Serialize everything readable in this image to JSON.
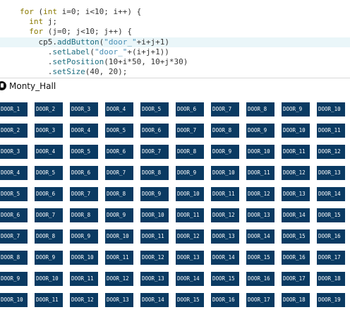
{
  "editor": {
    "lines": [
      [
        {
          "c": "kw",
          "t": "for"
        },
        {
          "c": "tx",
          "t": " ("
        },
        {
          "c": "kw",
          "t": "int"
        },
        {
          "c": "tx",
          "t": " i=0; i<10; i++) {"
        }
      ],
      [
        {
          "c": "tx",
          "t": "  "
        },
        {
          "c": "kw",
          "t": "int"
        },
        {
          "c": "tx",
          "t": " j;"
        }
      ],
      [
        {
          "c": "tx",
          "t": "  "
        },
        {
          "c": "kw",
          "t": "for"
        },
        {
          "c": "tx",
          "t": " (j=0; j<10; j++) {"
        }
      ],
      [
        {
          "c": "tx",
          "t": "    cp5."
        },
        {
          "c": "fn",
          "t": "addButton"
        },
        {
          "c": "tx",
          "t": "("
        },
        {
          "c": "str",
          "t": "\"door_\""
        },
        {
          "c": "tx",
          "t": "+i+j+1)"
        }
      ],
      [
        {
          "c": "tx",
          "t": "      ."
        },
        {
          "c": "fn",
          "t": "setLabel"
        },
        {
          "c": "tx",
          "t": "("
        },
        {
          "c": "str",
          "t": "\"door_\""
        },
        {
          "c": "tx",
          "t": "+(i+j+1))"
        }
      ],
      [
        {
          "c": "tx",
          "t": "      ."
        },
        {
          "c": "fn",
          "t": "setPosition"
        },
        {
          "c": "tx",
          "t": "(10+i*50, 10+j*30)"
        }
      ],
      [
        {
          "c": "tx",
          "t": "      ."
        },
        {
          "c": "fn",
          "t": "setSize"
        },
        {
          "c": "tx",
          "t": "(40, 20);"
        }
      ]
    ],
    "highlighted_line": 3
  },
  "window": {
    "title": "Monty_Hall"
  },
  "doors": {
    "columns": 10,
    "rows": 10,
    "rows_labels": [
      [
        "DOOR_1",
        "DOOR_2",
        "DOOR_3",
        "DOOR_4",
        "DOOR_5",
        "DOOR_6",
        "DOOR_7",
        "DOOR_8",
        "DOOR_9",
        "DOOR_10"
      ],
      [
        "DOOR_2",
        "DOOR_3",
        "DOOR_4",
        "DOOR_5",
        "DOOR_6",
        "DOOR_7",
        "DOOR_8",
        "DOOR_9",
        "DOOR_10",
        "DOOR_11"
      ],
      [
        "DOOR_3",
        "DOOR_4",
        "DOOR_5",
        "DOOR_6",
        "DOOR_7",
        "DOOR_8",
        "DOOR_9",
        "DOOR_10",
        "DOOR_11",
        "DOOR_12"
      ],
      [
        "DOOR_4",
        "DOOR_5",
        "DOOR_6",
        "DOOR_7",
        "DOOR_8",
        "DOOR_9",
        "DOOR_10",
        "DOOR_11",
        "DOOR_12",
        "DOOR_13"
      ],
      [
        "DOOR_5",
        "DOOR_6",
        "DOOR_7",
        "DOOR_8",
        "DOOR_9",
        "DOOR_10",
        "DOOR_11",
        "DOOR_12",
        "DOOR_13",
        "DOOR_14"
      ],
      [
        "DOOR_6",
        "DOOR_7",
        "DOOR_8",
        "DOOR_9",
        "DOOR_10",
        "DOOR_11",
        "DOOR_12",
        "DOOR_13",
        "DOOR_14",
        "DOOR_15"
      ],
      [
        "DOOR_7",
        "DOOR_8",
        "DOOR_9",
        "DOOR_10",
        "DOOR_11",
        "DOOR_12",
        "DOOR_13",
        "DOOR_14",
        "DOOR_15",
        "DOOR_16"
      ],
      [
        "DOOR_8",
        "DOOR_9",
        "DOOR_10",
        "DOOR_11",
        "DOOR_12",
        "DOOR_13",
        "DOOR_14",
        "DOOR_15",
        "DOOR_16",
        "DOOR_17"
      ],
      [
        "DOOR_9",
        "DOOR_10",
        "DOOR_11",
        "DOOR_12",
        "DOOR_13",
        "DOOR_14",
        "DOOR_15",
        "DOOR_16",
        "DOOR_17",
        "DOOR_18"
      ],
      [
        "DOOR_10",
        "DOOR_11",
        "DOOR_12",
        "DOOR_13",
        "DOOR_14",
        "DOOR_15",
        "DOOR_16",
        "DOOR_17",
        "DOOR_18",
        "DOOR_19"
      ]
    ],
    "color": "#0a3a62",
    "text_color": "#ffffff"
  }
}
